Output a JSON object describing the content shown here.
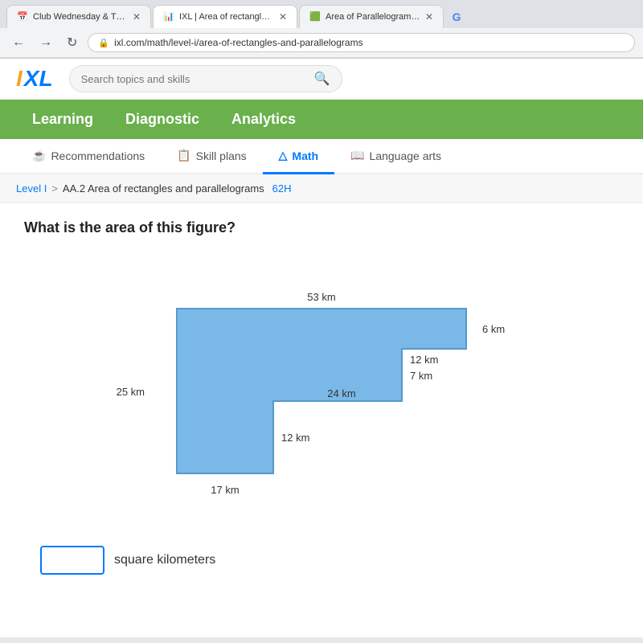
{
  "browser": {
    "tabs": [
      {
        "label": "Club Wednesday & Thurs",
        "active": false,
        "favicon": "📅"
      },
      {
        "label": "IXL | Area of rectangles and para…",
        "active": true,
        "favicon": "📊"
      },
      {
        "label": "Area of Parallelogram OR Area o…",
        "active": false,
        "favicon": "🟩"
      }
    ],
    "url": "ixl.com/math/level-i/area-of-rectangles-and-parallelograms",
    "google_favicon": "G"
  },
  "header": {
    "logo_i": "I",
    "logo_xl": "XL",
    "search_placeholder": "Search topics and skills"
  },
  "nav": {
    "items": [
      {
        "label": "Learning",
        "active": true
      },
      {
        "label": "Diagnostic",
        "active": false
      },
      {
        "label": "Analytics",
        "active": false
      }
    ]
  },
  "subnav": {
    "items": [
      {
        "label": "Recommendations",
        "icon": "☕",
        "active": false
      },
      {
        "label": "Skill plans",
        "icon": "📋",
        "active": false
      },
      {
        "label": "Math",
        "icon": "△",
        "active": true
      },
      {
        "label": "Language arts",
        "icon": "📖",
        "active": false
      }
    ]
  },
  "breadcrumb": {
    "level": "Level I",
    "separator": ">",
    "topic": "AA.2 Area of rectangles and parallelograms",
    "code": "62H"
  },
  "question": {
    "text": "What is the area of this figure?"
  },
  "figure": {
    "labels": {
      "top": "53 km",
      "right_top": "6 km",
      "right_mid_top": "12 km",
      "right_mid_bot": "7 km",
      "left": "25 km",
      "center_h": "24 km",
      "center_v": "12 km",
      "bottom": "17 km"
    }
  },
  "answer": {
    "placeholder": "",
    "unit": "square kilometers"
  }
}
